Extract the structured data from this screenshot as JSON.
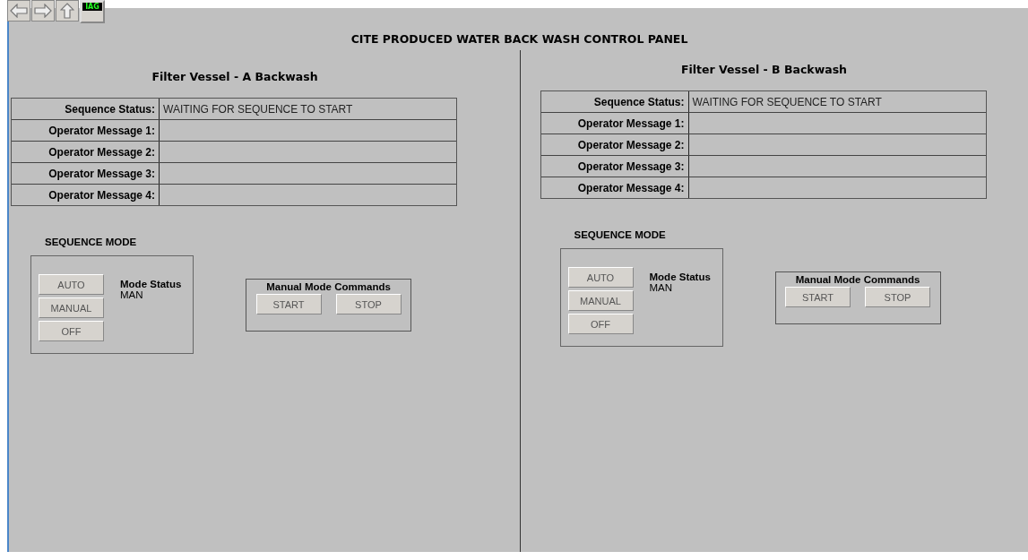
{
  "toolbar": {
    "logo_text": "IAG"
  },
  "title": "CITE PRODUCED WATER BACK WASH CONTROL PANEL",
  "vessels": [
    {
      "heading": "Filter Vessel - A Backwash",
      "rows": [
        {
          "label": "Sequence Status:",
          "value": "WAITING FOR SEQUENCE TO START"
        },
        {
          "label": "Operator Message 1:"
        },
        {
          "label": "Operator Message 2:"
        },
        {
          "label": "Operator Message 3:"
        },
        {
          "label": "Operator Message 4:"
        }
      ],
      "sequence_mode": {
        "title": "SEQUENCE MODE",
        "buttons": [
          "AUTO",
          "MANUAL",
          "OFF"
        ],
        "status_label": "Mode Status",
        "status_value": "MAN"
      },
      "manual": {
        "title": "Manual Mode Commands",
        "buttons": [
          "START",
          "STOP"
        ]
      }
    },
    {
      "heading": "Filter Vessel - B Backwash",
      "rows": [
        {
          "label": "Sequence Status:",
          "value": "WAITING FOR SEQUENCE TO START"
        },
        {
          "label": "Operator Message 1:"
        },
        {
          "label": "Operator Message 2:"
        },
        {
          "label": "Operator Message 3:"
        },
        {
          "label": "Operator Message 4:"
        }
      ],
      "sequence_mode": {
        "title": "SEQUENCE MODE",
        "buttons": [
          "AUTO",
          "MANUAL",
          "OFF"
        ],
        "status_label": "Mode Status",
        "status_value": "MAN"
      },
      "manual": {
        "title": "Manual Mode Commands",
        "buttons": [
          "START",
          "STOP"
        ]
      }
    }
  ]
}
